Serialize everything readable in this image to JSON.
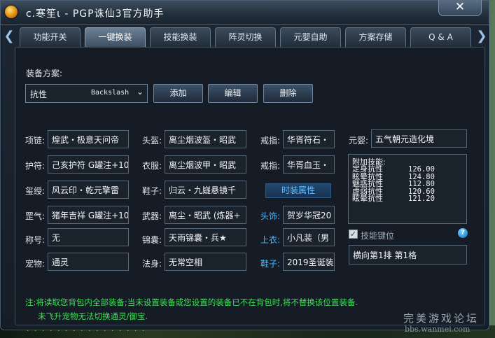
{
  "window": {
    "title": "c.寒笙ι - PGP诛仙3官方助手",
    "close_label": "✕",
    "nav_left": "❮",
    "nav_right": "❯"
  },
  "tabs": [
    {
      "label": "功能开关",
      "active": false
    },
    {
      "label": "一键换装",
      "active": true
    },
    {
      "label": "技能换装",
      "active": false
    },
    {
      "label": "阵灵切换",
      "active": false
    },
    {
      "label": "元婴自助",
      "active": false
    },
    {
      "label": "方案存储",
      "active": false
    },
    {
      "label": "Q & A",
      "active": false
    }
  ],
  "scheme": {
    "label": "装备方案:",
    "selected": "抗性",
    "hotkey": "Backslash",
    "dropdown_icon": "chevron-down-icon",
    "add_label": "添加",
    "edit_label": "编辑",
    "delete_label": "删除"
  },
  "equipment": {
    "col1": [
      {
        "label": "项链:",
        "value": "煌武・极意天问帝"
      },
      {
        "label": "护符:",
        "value": "己亥护符 G罐注+10"
      },
      {
        "label": "玺绶:",
        "value": "风云印・乾元擎雷"
      },
      {
        "label": "罡气:",
        "value": "猪年吉祥 G罐注+10"
      },
      {
        "label": "称号:",
        "value": "无"
      },
      {
        "label": "宠物:",
        "value": "通灵"
      }
    ],
    "col2": [
      {
        "label": "头盔:",
        "value": "离尘烟波盔・昭武"
      },
      {
        "label": "衣服:",
        "value": "离尘烟波甲・昭武"
      },
      {
        "label": "鞋子:",
        "value": "归云・九嶷悬镜千"
      },
      {
        "label": "武器:",
        "value": "离尘・昭武 (炼器+"
      },
      {
        "label": "锦囊:",
        "value": "天雨锦囊・兵★"
      },
      {
        "label": "法身:",
        "value": "无常空相"
      }
    ],
    "col3": [
      {
        "label": "戒指:",
        "value": "华胥符石・"
      },
      {
        "label": "戒指:",
        "value": "华胥血玉・"
      },
      {
        "label": "头饰:",
        "value": "贺岁华冠20"
      },
      {
        "label": "上衣:",
        "value": "小凡装（男"
      },
      {
        "label": "鞋子:",
        "value": "2019圣诞装"
      }
    ],
    "fashion_label": "时装属性"
  },
  "yuanying": {
    "label": "元婴:",
    "value": "五气朝元造化境",
    "skills_title": "附加技能:",
    "skills": [
      {
        "name": "定身抗性",
        "value": "126.00"
      },
      {
        "name": "眩晕抗性",
        "value": "124.80"
      },
      {
        "name": "魅惑抗性",
        "value": "112.80"
      },
      {
        "name": "虚弱抗性",
        "value": "120.60"
      },
      {
        "name": "眩晕抗性",
        "value": "121.20"
      }
    ],
    "key_slot_label": "技能键位",
    "key_slot_checked": "✓",
    "help_icon": "?",
    "key_slot_value": "横向第1排 第1格"
  },
  "notes": {
    "line1": "注:将读取您背包内全部装备;当未设置装备或您设置的装备已不在背包时,将不替换该位置装备.",
    "line2": "未飞升宠物无法切换通灵/御宝."
  },
  "watermark": {
    "line1": "完美游戏论坛",
    "line2": "bbs.wanmei.com"
  }
}
